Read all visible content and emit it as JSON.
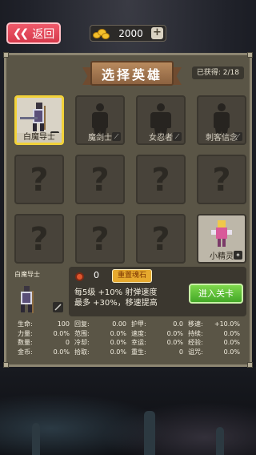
{
  "top_bar": {
    "back_label": "返回",
    "back_icon": "double-chevron-left",
    "gold_amount": "2000",
    "gold_icon": "gold-pile-icon",
    "plus_label": "+"
  },
  "panel": {
    "title": "选择英雄",
    "owned": "已获得: 2/18"
  },
  "heroes": [
    {
      "name": "白魔导士",
      "state": "selected"
    },
    {
      "name": "魔剑士",
      "state": "locked"
    },
    {
      "name": "女忍者",
      "state": "locked"
    },
    {
      "name": "刺客信念",
      "state": "locked"
    },
    {
      "name": "",
      "state": "unknown"
    },
    {
      "name": "",
      "state": "unknown"
    },
    {
      "name": "",
      "state": "unknown"
    },
    {
      "name": "",
      "state": "unknown"
    },
    {
      "name": "",
      "state": "unknown"
    },
    {
      "name": "",
      "state": "unknown"
    },
    {
      "name": "",
      "state": "unknown"
    },
    {
      "name": "小精灵",
      "state": "owned"
    }
  ],
  "selected": {
    "name": "白魔导士",
    "gem_count": "0",
    "reset_label": "重置魂石",
    "desc_line1": "每5级 +10% 射弹速度",
    "desc_line2": "最多 +30%，移速提高",
    "enter_label": "进入关卡"
  },
  "stats": [
    [
      [
        "生命:",
        "100"
      ],
      [
        "回复:",
        "0.00"
      ],
      [
        "护甲:",
        "0.0"
      ],
      [
        "移速:",
        "+10.0%"
      ]
    ],
    [
      [
        "力量:",
        "0.0%"
      ],
      [
        "范围:",
        "0.0%"
      ],
      [
        "速度:",
        "0.0%"
      ],
      [
        "持续:",
        "0.0%"
      ]
    ],
    [
      [
        "数量:",
        "0"
      ],
      [
        "冷却:",
        "0.0%"
      ],
      [
        "幸运:",
        "0.0%"
      ],
      [
        "经验:",
        "0.0%"
      ]
    ],
    [
      [
        "金币:",
        "0.0%"
      ],
      [
        "拾取:",
        "0.0%"
      ],
      [
        "重生:",
        "0"
      ],
      [
        "诅咒:",
        "0.0%"
      ]
    ]
  ]
}
